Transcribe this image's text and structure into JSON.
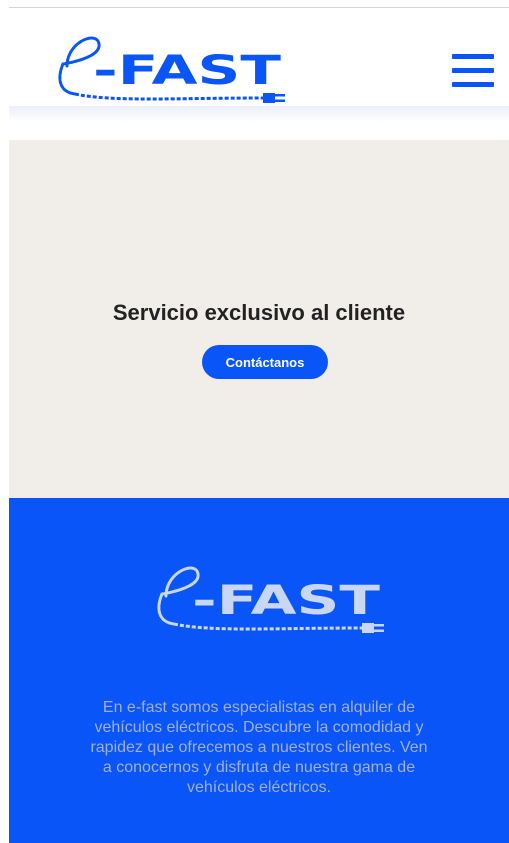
{
  "brand": {
    "logo_letter": "e",
    "logo_text": "-FAST",
    "color_primary": "#0a55f7"
  },
  "header": {
    "menu_icon": "hamburger-menu-icon"
  },
  "hero": {
    "title": "Servicio exclusivo al cliente",
    "cta_label": "Contáctanos",
    "background": "#f1eeea"
  },
  "about": {
    "description": "En e-fast somos especialistas en alquiler de vehículos eléctricos. Descubre la comodidad y rapidez que ofrecemos a nuestros clientes. Ven a conocernos y disfruta de nuestra gama de vehículos eléctricos.",
    "background": "#0a55f7"
  }
}
